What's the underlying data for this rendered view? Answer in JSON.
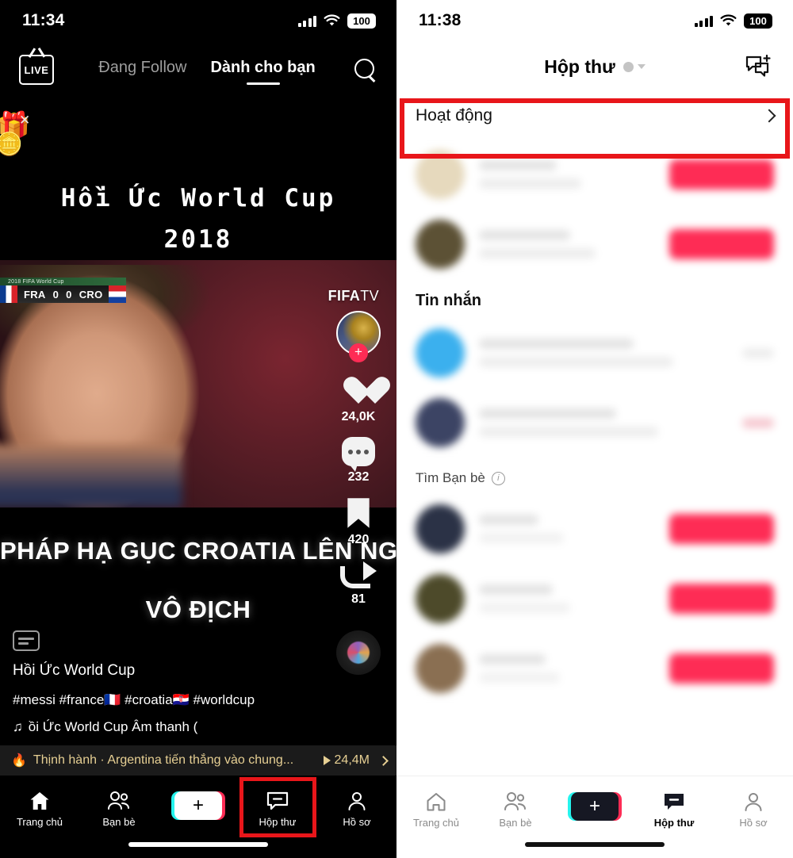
{
  "left_phone": {
    "status_bar": {
      "time": "11:34",
      "battery": "100",
      "wifi_icon": "wifi-icon",
      "signal_icon": "cellular-signal-icon"
    },
    "top_nav": {
      "live_label": "LIVE",
      "tabs": [
        {
          "label": "Đang Follow",
          "active": false
        },
        {
          "label": "Dành cho bạn",
          "active": true
        }
      ],
      "search_icon": "search-icon"
    },
    "gift_banner": {
      "gift_icon": "gift-box-icon",
      "coin_icon": "coin-icon",
      "close_icon": "close-icon"
    },
    "video": {
      "overlay_title_line1": "Hồi Ức World Cup",
      "overlay_title_line2": "2018",
      "scoreboard": {
        "competition": "2018 FIFA World Cup",
        "home_team": "FRA",
        "home_score": "0",
        "away_score": "0",
        "away_team": "CRO"
      },
      "broadcaster_bold": "FIFA",
      "broadcaster_light": "TV",
      "caption_line1": "PHÁP HẠ GỤC CROATIA LÊN NGÔI",
      "caption_line2": "VÔ ĐỊCH"
    },
    "action_rail": {
      "avatar_name": "creator-avatar",
      "follow_icon": "plus-icon",
      "like": {
        "icon": "heart-icon",
        "count": "24,0K"
      },
      "comment": {
        "icon": "comment-bubble-icon",
        "count": "232"
      },
      "bookmark": {
        "icon": "bookmark-icon",
        "count": "420"
      },
      "share": {
        "icon": "share-arrow-icon",
        "count": "81"
      },
      "music_disc": "music-disc-icon"
    },
    "meta": {
      "cc_icon": "closed-caption-icon",
      "author": "Hồi Ức World Cup",
      "hashtags": "#messi #france🇫🇷 #croatia🇭🇷 #worldcup",
      "music_note_icon": "music-note-icon",
      "music": "ồi Ức World Cup Âm thanh ("
    },
    "trending_bar": {
      "flame_icon": "flame-icon",
      "text": "Thịnh hành · Argentina tiến thẳng vào chung...",
      "play_icon": "play-triangle-icon",
      "plays": "24,4M",
      "chevron_icon": "chevron-right-icon"
    },
    "bottom_nav": {
      "items": [
        {
          "label": "Trang chủ",
          "icon": "home-icon",
          "active": true
        },
        {
          "label": "Bạn bè",
          "icon": "friends-icon",
          "active": false
        },
        {
          "label": "",
          "icon": "create-plus-icon",
          "active": false
        },
        {
          "label": "Hộp thư",
          "icon": "inbox-icon",
          "active": false
        },
        {
          "label": "Hồ sơ",
          "icon": "profile-icon",
          "active": false
        }
      ],
      "highlight": "Hộp thư"
    }
  },
  "right_phone": {
    "status_bar": {
      "time": "11:38",
      "battery": "100",
      "wifi_icon": "wifi-icon",
      "signal_icon": "cellular-signal-icon"
    },
    "header": {
      "title": "Hộp thư",
      "status_dot": "presence-dot-icon",
      "caret_icon": "chevron-down-icon",
      "new_message_icon": "new-message-icon"
    },
    "activity_row": {
      "label": "Hoạt động",
      "chevron_icon": "chevron-right-icon",
      "highlighted": true
    },
    "sections": [
      {
        "title": "Tin nhắn"
      },
      {
        "title": "Tìm Bạn bè",
        "info_icon": "info-icon"
      }
    ],
    "bottom_nav": {
      "items": [
        {
          "label": "Trang chủ",
          "icon": "home-icon",
          "active": false
        },
        {
          "label": "Bạn bè",
          "icon": "friends-icon",
          "active": false
        },
        {
          "label": "",
          "icon": "create-plus-icon",
          "active": false
        },
        {
          "label": "Hộp thư",
          "icon": "inbox-icon",
          "active": true
        },
        {
          "label": "Hồ sơ",
          "icon": "profile-icon",
          "active": false
        }
      ]
    }
  },
  "colors": {
    "accent_pink": "#fe2c55",
    "accent_cyan": "#25f4ee",
    "highlight_red": "#e8161a",
    "trending_gold": "#e6cf93"
  }
}
